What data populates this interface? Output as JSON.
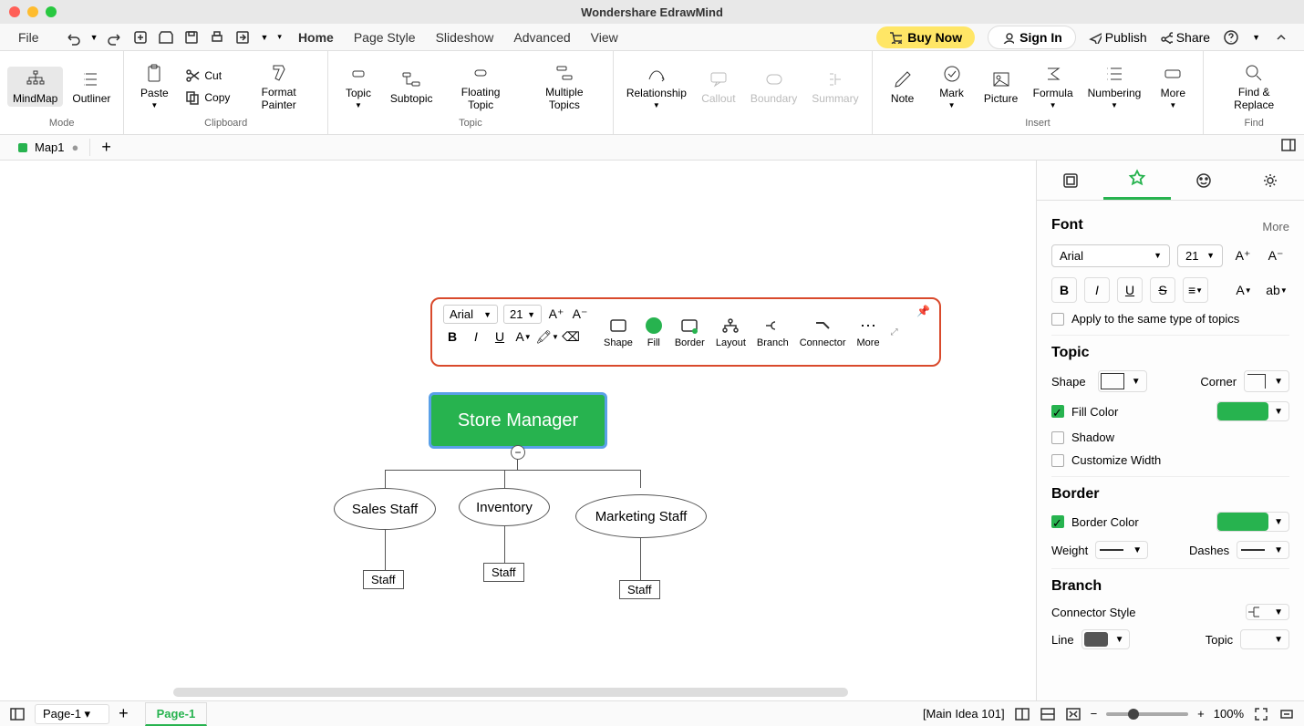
{
  "app_title": "Wondershare EdrawMind",
  "menu": [
    "File",
    "Home",
    "Page Style",
    "Slideshow",
    "Advanced",
    "View"
  ],
  "active_menu": "Home",
  "buy_now": "Buy Now",
  "sign_in": "Sign In",
  "publish": "Publish",
  "share": "Share",
  "ribbon": {
    "mode": {
      "mindmap": "MindMap",
      "outliner": "Outliner",
      "label": "Mode"
    },
    "clipboard": {
      "paste": "Paste",
      "cut": "Cut",
      "copy": "Copy",
      "format_painter": "Format Painter",
      "label": "Clipboard"
    },
    "topic": {
      "topic": "Topic",
      "subtopic": "Subtopic",
      "floating": "Floating Topic",
      "multiple": "Multiple Topics",
      "label": "Topic"
    },
    "structure": {
      "relationship": "Relationship",
      "callout": "Callout",
      "boundary": "Boundary",
      "summary": "Summary"
    },
    "insert": {
      "note": "Note",
      "mark": "Mark",
      "picture": "Picture",
      "formula": "Formula",
      "numbering": "Numbering",
      "more": "More",
      "label": "Insert"
    },
    "find": {
      "find_replace": "Find & Replace",
      "label": "Find"
    }
  },
  "file_tab": "Map1",
  "floating_toolbar": {
    "font": "Arial",
    "size": "21",
    "shape": "Shape",
    "fill": "Fill",
    "border": "Border",
    "layout": "Layout",
    "branch": "Branch",
    "connector": "Connector",
    "more": "More"
  },
  "mindmap": {
    "root": "Store Manager",
    "children": [
      {
        "label": "Sales Staff",
        "leaf": "Staff"
      },
      {
        "label": "Inventory",
        "leaf": "Staff"
      },
      {
        "label": "Marketing Staff",
        "leaf": "Staff"
      }
    ]
  },
  "sidepanel": {
    "font": {
      "title": "Font",
      "more": "More",
      "family": "Arial",
      "size": "21",
      "apply_same": "Apply to the same type of topics"
    },
    "topic": {
      "title": "Topic",
      "shape": "Shape",
      "corner": "Corner",
      "fill_color": "Fill Color",
      "shadow": "Shadow",
      "customize_width": "Customize Width",
      "fill_hex": "#27b34f"
    },
    "border": {
      "title": "Border",
      "border_color": "Border Color",
      "weight": "Weight",
      "dashes": "Dashes",
      "hex": "#27b34f"
    },
    "branch": {
      "title": "Branch",
      "connector_style": "Connector Style",
      "line": "Line",
      "topic": "Topic"
    }
  },
  "status": {
    "page_select": "Page-1",
    "page_tab": "Page-1",
    "context": "[Main Idea 101]",
    "zoom": "100%"
  }
}
